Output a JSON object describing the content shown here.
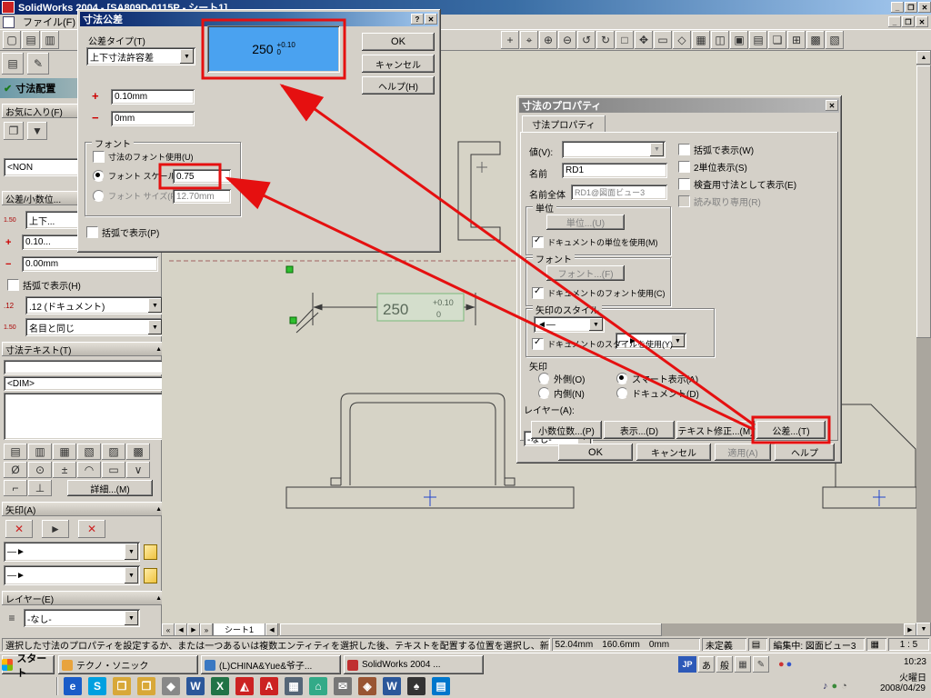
{
  "icons": {
    "close": "✕",
    "min": "_",
    "max": "❐",
    "help": "?",
    "dd": "▼",
    "up": "▲",
    "down": "▼",
    "left": "◀",
    "right": "▶",
    "first": "«",
    "last": "»",
    "check": "✔"
  },
  "window": {
    "title": "SolidWorks 2004 - [SA809D-0115P - シート1]",
    "menu_file": "ファイル(F)"
  },
  "toolbar": {
    "left_icons": [
      {
        "g": "▢"
      },
      {
        "g": "▤"
      },
      {
        "g": "▥"
      }
    ],
    "right_icons": [
      {
        "g": "+"
      },
      {
        "g": "⌖"
      },
      {
        "g": "⊕"
      },
      {
        "g": "⊖"
      },
      {
        "g": "↺"
      },
      {
        "g": "↻"
      },
      {
        "g": "□"
      },
      {
        "g": "✥"
      },
      {
        "g": "▭"
      },
      {
        "g": "◇"
      },
      {
        "g": "▦"
      },
      {
        "g": "◫"
      },
      {
        "g": "▣"
      },
      {
        "g": "▤"
      },
      {
        "g": "❏"
      },
      {
        "g": "⊞"
      },
      {
        "g": "▩"
      },
      {
        "g": "▧"
      }
    ]
  },
  "panel": {
    "tab_icons": [
      {
        "g": "▤"
      },
      {
        "g": "✎"
      }
    ],
    "title": "寸法配置",
    "favorites_header": "お気に入り(F)",
    "fav_icons": [
      {
        "g": "❐"
      },
      {
        "g": "▼"
      }
    ],
    "favorites_value": "<NON",
    "tol_header": "公差/小数位...",
    "badge_tol": "1.50",
    "tol_type": "上下...",
    "plus": "+",
    "plus_value": "0.10...",
    "minus": "−",
    "minus_value": "0.00mm",
    "paren": "括弧で表示(H)",
    "badge_prec": ".12",
    "precision": ".12 (ドキュメント)",
    "badge_tolprec": "1.50",
    "tol_precision": "名目と同じ",
    "text_header": "寸法テキスト(T)",
    "dim_token": "<DIM>",
    "align_icons": [
      {
        "g": "▤"
      },
      {
        "g": "▥"
      },
      {
        "g": "▦"
      },
      {
        "g": "▧"
      },
      {
        "g": "▨"
      },
      {
        "g": "▩"
      }
    ],
    "sym_icons": [
      {
        "g": "Ø"
      },
      {
        "g": "⊙"
      },
      {
        "g": "±"
      },
      {
        "g": "◠"
      },
      {
        "g": "▭"
      },
      {
        "g": "∨"
      }
    ],
    "sym_icons2": [
      {
        "g": "⌐"
      },
      {
        "g": "⊥"
      }
    ],
    "more_button": "詳細...(M)",
    "arrow_header": "矢印(A)",
    "arrow_toggles": [
      {
        "g": "✕",
        "c": "#cc2222"
      },
      {
        "g": "►",
        "c": "#333333"
      },
      {
        "g": "✕",
        "c": "#cc2222"
      }
    ],
    "arrow_style1": "—►",
    "arrow_style2": "—►",
    "layer_header": "レイヤー(E)",
    "layer_value": "-なし-"
  },
  "tolerance": {
    "title": "寸法公差",
    "type_label": "公差タイプ(T)",
    "type_value": "上下寸法許容差",
    "preview": {
      "value": "250",
      "upper": "+0.10",
      "lower": "0"
    },
    "plus_sign": "+",
    "plus_value": "0.10mm",
    "minus_sign": "−",
    "minus_value": "0mm",
    "font_group": "フォント",
    "use_dim_font": "寸法のフォント使用(U)",
    "font_scale": "フォント スケール(S)",
    "font_scale_value": "0.75",
    "font_size": "フォント サイズ(F)",
    "font_size_value": "12.70mm",
    "show_paren": "括弧で表示(P)",
    "ok": "OK",
    "cancel": "キャンセル",
    "help": "ヘルプ(H)"
  },
  "props": {
    "title": "寸法のプロパティ",
    "tab": "寸法プロパティ",
    "value_label": "値(V):",
    "cb_paren": "括弧で表示(W)",
    "cb_dual": "2単位表示(S)",
    "cb_inspection": "検査用寸法として表示(E)",
    "cb_readonly": "読み取り専用(R)",
    "name_label": "名前",
    "name_value": "RD1",
    "full_name_label": "名前全体",
    "full_name_value": "RD1@図面ビュー3",
    "unit_group": "単位",
    "unit_button": "単位...(U)",
    "cb_doc_units": "ドキュメントの単位を使用(M)",
    "font_group": "フォント",
    "font_button": "フォント...(F)",
    "cb_doc_font": "ドキュメントのフォント使用(C)",
    "arrow_style_group": "矢印のスタイル",
    "arrow_left": "◄—",
    "arrow_right": "—►",
    "cb_doc_style": "ドキュメントのスタイルを使用(Y)",
    "arrow_group": "矢印",
    "r_outside": "外側(O)",
    "r_inside": "内側(N)",
    "r_smart": "スマート表示(A)",
    "r_document": "ドキュメント(D)",
    "layer_label": "レイヤー(A):",
    "layer_value": "-なし-",
    "btn_precision": "小数位数...(P)",
    "btn_display": "表示...(D)",
    "btn_text": "テキスト修正...(M)",
    "btn_tolerance": "公差...(T)",
    "ok": "OK",
    "cancel": "キャンセル",
    "apply": "適用(A)",
    "help": "ヘルプ"
  },
  "drawing": {
    "dim_value": "250",
    "dim_upper": "+0.10",
    "dim_lower": "0",
    "sheet_tab": "シート1"
  },
  "status": {
    "message": "選択した寸法のプロパティを設定するか、または一つあるいは複数エンティティを選択した後、テキストを配置する位置を選択し、新しい寸法を作成してください。",
    "x": "52.04mm",
    "y": "160.6mm",
    "z": "0mm",
    "state": "未定義",
    "editing": "編集中: 図面ビュー3",
    "scale": "1 : 5"
  },
  "taskbar": {
    "start": "スタート",
    "tasks": [
      {
        "label": "テクノ・ソニック",
        "c": "#e8a33d"
      },
      {
        "label": "(L)CHINA&Yue&爷子...",
        "c": "#3a78c2"
      },
      {
        "label": "SolidWorks 2004 ...",
        "c": "#c03030"
      }
    ],
    "lang": "JP",
    "ime_a": "あ",
    "ime_b": "般",
    "lang_icons": [
      {
        "g": "▦",
        "c": "#444"
      },
      {
        "g": "✎",
        "c": "#444"
      }
    ],
    "tray1": [
      {
        "g": "●",
        "c": "#cc3333"
      },
      {
        "g": "●",
        "c": "#3355cc"
      }
    ],
    "tray3": [
      {
        "g": "♪",
        "c": "#336"
      },
      {
        "g": "●",
        "c": "#3a8a3a"
      },
      {
        "g": "◔",
        "c": "#555"
      }
    ],
    "time": "10:23",
    "day": "火曜日",
    "date": "2008/04/29"
  },
  "quick_launch": [
    {
      "g": "e",
      "c": "#1a5cc8"
    },
    {
      "g": "S",
      "c": "#00a0e0"
    },
    {
      "g": "❒",
      "c": "#d8a838"
    },
    {
      "g": "❒",
      "c": "#d8a838"
    },
    {
      "g": "◆",
      "c": "#888888"
    },
    {
      "g": "W",
      "c": "#2b579a"
    },
    {
      "g": "X",
      "c": "#217346"
    },
    {
      "g": "◭",
      "c": "#cc2222"
    },
    {
      "g": "A",
      "c": "#cc2222"
    },
    {
      "g": "▦",
      "c": "#556677"
    },
    {
      "g": "⌂",
      "c": "#33aa88"
    },
    {
      "g": "✉",
      "c": "#777777"
    },
    {
      "g": "◈",
      "c": "#995533"
    },
    {
      "g": "W",
      "c": "#2b579a"
    },
    {
      "g": "♠",
      "c": "#333333"
    },
    {
      "g": "▤",
      "c": "#0077cc"
    }
  ]
}
